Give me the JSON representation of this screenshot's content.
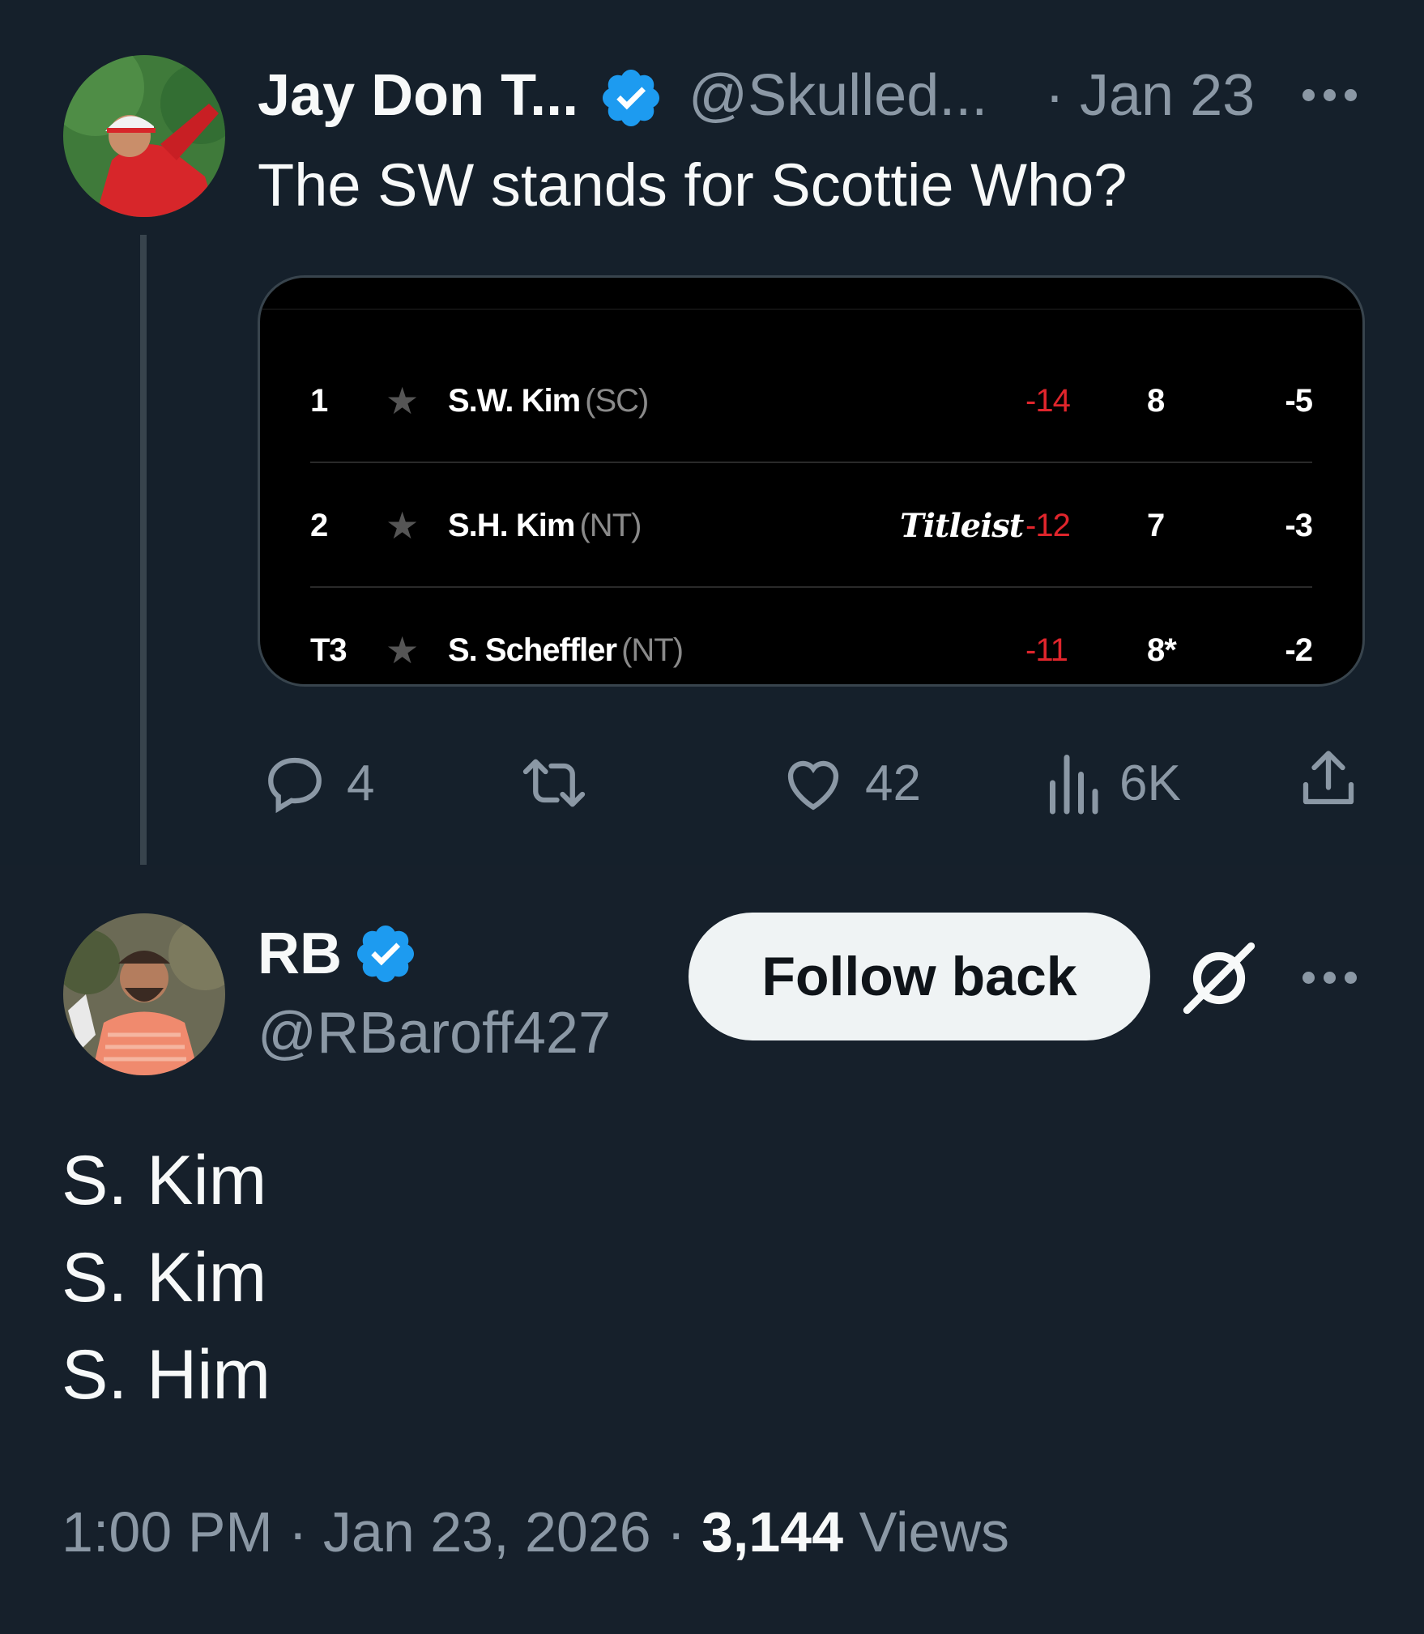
{
  "parent": {
    "name": "Jay Don T...",
    "handle": "@Skulled...",
    "separator": "·",
    "date": "Jan 23",
    "text": "The SW stands for Scottie Who?",
    "leaderboard": [
      {
        "pos": "1",
        "player": "S.W. Kim",
        "team": "(SC)",
        "sponsor": "",
        "score": "-14",
        "thru": "8",
        "today": "-5"
      },
      {
        "pos": "2",
        "player": "S.H. Kim",
        "team": "(NT)",
        "sponsor": "Titleist",
        "score": "-12",
        "thru": "7",
        "today": "-3"
      },
      {
        "pos": "T3",
        "player": "S. Scheffler",
        "team": "(NT)",
        "sponsor": "",
        "score": "-11",
        "thru": "8*",
        "today": "-2"
      }
    ],
    "actions": {
      "replies": "4",
      "retweets": "",
      "likes": "42",
      "views": "6K"
    }
  },
  "reply": {
    "name": "RB",
    "handle": "@RBaroff427",
    "follow_label": "Follow back",
    "lines": [
      "S. Kim",
      "S. Kim",
      "S. Him"
    ],
    "time": "1:00 PM",
    "dot": "·",
    "date": "Jan 23, 2026",
    "views_count": "3,144",
    "views_label": "Views"
  },
  "colors": {
    "background": "#15202b",
    "verified": "#1d9bf0",
    "muted": "#8b98a5",
    "score_red": "#e0252c"
  },
  "icons": [
    "verified-badge-icon",
    "more-icon",
    "reply-icon",
    "retweet-icon",
    "like-icon",
    "views-icon",
    "share-icon",
    "grok-icon",
    "star-icon"
  ]
}
